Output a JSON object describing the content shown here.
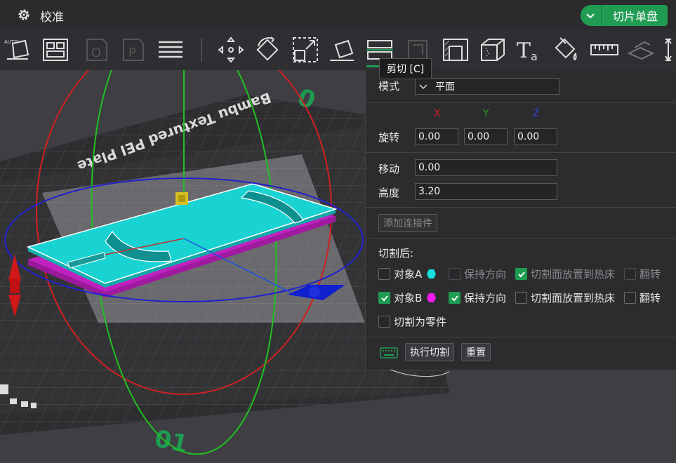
{
  "titlebar": {
    "title": "校准",
    "slice_label": "切片单盘"
  },
  "tooltip": "剪切 [C]",
  "panel": {
    "mode_label": "模式",
    "mode_value": "平面",
    "axis_x": "X",
    "axis_y": "Y",
    "axis_z": "Z",
    "rotation_label": "旋转",
    "rotation": {
      "x": "0.00",
      "y": "0.00",
      "z": "0.00"
    },
    "move_label": "移动",
    "move_value": "0.00",
    "height_label": "高度",
    "height_value": "3.20",
    "add_connector": "添加连接件",
    "after_cut_label": "切割后:",
    "object_a": {
      "label": "对象A",
      "keep_orientation": "保持方向",
      "place_on_bed": "切割面放置到热床",
      "flip": "翻转"
    },
    "object_b": {
      "label": "对象B",
      "keep_orientation": "保持方向",
      "place_on_bed": "切割面放置到热床",
      "flip": "翻转"
    },
    "cut_to_parts": "切割为零件",
    "execute": "执行切割",
    "reset": "重置"
  },
  "viewport": {
    "plate_text": "Bambu Textured PEI Plate",
    "plate_number": "01",
    "colors": {
      "object_a": "#19d3d3",
      "object_b": "#e619e6",
      "accent": "#1f9c52"
    }
  }
}
